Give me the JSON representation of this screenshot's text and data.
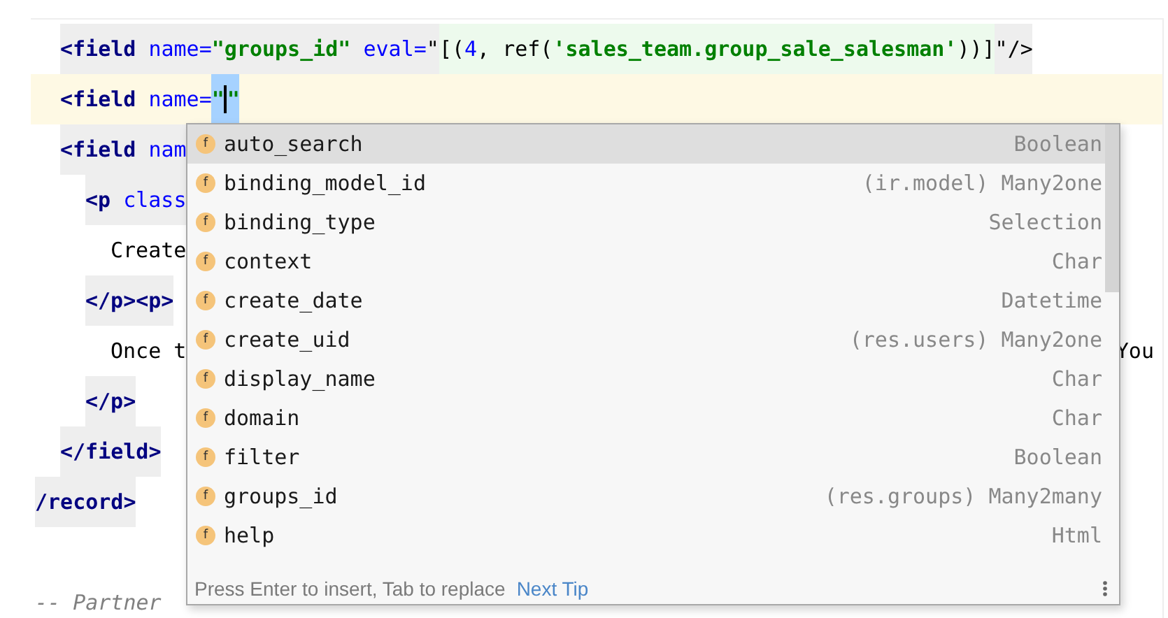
{
  "editor": {
    "lines": [
      {
        "kind": "attribute",
        "current": false,
        "tokens": [
          {
            "kind": "tag",
            "text": "<field"
          },
          {
            "kind": "attr",
            "text": " name="
          },
          {
            "kind": "str",
            "text": "\"groups_id\""
          },
          {
            "kind": "attr",
            "text": " eval="
          },
          {
            "kind": "plain",
            "text": "\""
          },
          {
            "kind": "expr-plain",
            "text": "[("
          },
          {
            "kind": "expr-num",
            "text": "4"
          },
          {
            "kind": "expr-plain",
            "text": ", ref("
          },
          {
            "kind": "expr-str",
            "text": "'sales_team.group_sale_salesman'"
          },
          {
            "kind": "expr-plain",
            "text": "))]"
          },
          {
            "kind": "plain",
            "text": "\"/>"
          }
        ]
      },
      {
        "kind": "attribute",
        "current": true,
        "tokens": [
          {
            "kind": "tag",
            "text": "<field"
          },
          {
            "kind": "attr",
            "text": " name="
          },
          {
            "kind": "sel-str",
            "text": "\""
          },
          {
            "kind": "caret"
          },
          {
            "kind": "sel-str",
            "text": "\""
          }
        ]
      },
      {
        "kind": "attribute",
        "current": false,
        "tokens": [
          {
            "kind": "tag",
            "text": "<field"
          },
          {
            "kind": "attr",
            "text": " nam"
          }
        ]
      },
      {
        "kind": "element",
        "current": false,
        "tokens": [
          {
            "kind": "tag",
            "text": "<p"
          },
          {
            "kind": "attr",
            "text": " class"
          }
        ]
      },
      {
        "kind": "content",
        "current": false,
        "tokens": [
          {
            "kind": "text",
            "text": "Create"
          }
        ]
      },
      {
        "kind": "element",
        "current": false,
        "tokens": [
          {
            "kind": "tag",
            "text": "</p><p>"
          }
        ]
      },
      {
        "kind": "content",
        "current": false,
        "tokens": [
          {
            "kind": "text",
            "text": "Once t"
          },
          {
            "kind": "tail",
            "text": "You"
          }
        ]
      },
      {
        "kind": "element",
        "current": false,
        "tokens": [
          {
            "kind": "tag",
            "text": "</p>"
          }
        ]
      },
      {
        "kind": "attribute",
        "current": false,
        "tokens": [
          {
            "kind": "tag",
            "text": "</field>"
          }
        ]
      },
      {
        "kind": "root",
        "current": false,
        "tokens": [
          {
            "kind": "tag",
            "text": "/record>"
          }
        ]
      },
      {
        "kind": "root",
        "current": false
      },
      {
        "kind": "root",
        "current": false,
        "tokens": [
          {
            "kind": "comment",
            "text": "-- Partner"
          }
        ]
      }
    ]
  },
  "completion_popup": {
    "items": [
      {
        "icon": "f",
        "name": "auto_search",
        "type": "Boolean",
        "selected": true
      },
      {
        "icon": "f",
        "name": "binding_model_id",
        "type": "(ir.model) Many2one",
        "selected": false
      },
      {
        "icon": "f",
        "name": "binding_type",
        "type": "Selection",
        "selected": false
      },
      {
        "icon": "f",
        "name": "context",
        "type": "Char",
        "selected": false
      },
      {
        "icon": "f",
        "name": "create_date",
        "type": "Datetime",
        "selected": false
      },
      {
        "icon": "f",
        "name": "create_uid",
        "type": "(res.users) Many2one",
        "selected": false
      },
      {
        "icon": "f",
        "name": "display_name",
        "type": "Char",
        "selected": false
      },
      {
        "icon": "f",
        "name": "domain",
        "type": "Char",
        "selected": false
      },
      {
        "icon": "f",
        "name": "filter",
        "type": "Boolean",
        "selected": false
      },
      {
        "icon": "f",
        "name": "groups_id",
        "type": "(res.groups) Many2many",
        "selected": false
      },
      {
        "icon": "f",
        "name": "help",
        "type": "Html",
        "selected": false
      }
    ],
    "hint": "Press Enter to insert, Tab to replace",
    "hint_link": "Next Tip"
  }
}
